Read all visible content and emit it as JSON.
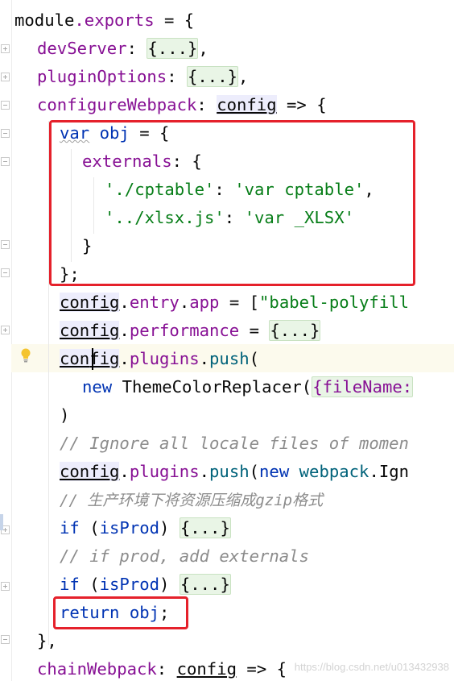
{
  "editor": {
    "lines": [
      {
        "id": "l1",
        "parts": {
          "a": "module",
          "b": ".exports",
          "c": " = {"
        }
      },
      {
        "id": "l2",
        "parts": {
          "a": "devServer",
          "b": ": ",
          "c": "{...}",
          "d": ","
        }
      },
      {
        "id": "l3",
        "parts": {
          "a": "pluginOptions",
          "b": ": ",
          "c": "{...}",
          "d": ","
        }
      },
      {
        "id": "l4",
        "parts": {
          "a": "configureWebpack",
          "b": ": ",
          "c": "config",
          "d": " => {"
        }
      },
      {
        "id": "l5",
        "parts": {
          "a": "var",
          "b": " ",
          "c": "obj",
          "d": " = {"
        }
      },
      {
        "id": "l6",
        "parts": {
          "a": "externals",
          "b": ": {"
        }
      },
      {
        "id": "l7",
        "parts": {
          "a": "'./cptable'",
          "b": ": ",
          "c": "'var cptable'",
          "d": ","
        }
      },
      {
        "id": "l8",
        "parts": {
          "a": "'../xlsx.js'",
          "b": ": ",
          "c": "'var _XLSX'"
        }
      },
      {
        "id": "l9",
        "parts": {
          "a": "}"
        }
      },
      {
        "id": "l10",
        "parts": {
          "a": "};"
        }
      },
      {
        "id": "l11",
        "parts": {
          "a": "config",
          "b": ".",
          "c": "entry",
          "d": ".",
          "e": "app",
          "f": " = [",
          "g": "\"babel-polyfill"
        }
      },
      {
        "id": "l12",
        "parts": {
          "a": "config",
          "b": ".",
          "c": "performance",
          "d": " = ",
          "e": "{...}"
        }
      },
      {
        "id": "l13",
        "parts": {
          "a": "con",
          "b": "fig",
          "c": ".",
          "d": "plugins",
          "e": ".",
          "f": "push",
          "g": "("
        }
      },
      {
        "id": "l14",
        "parts": {
          "a": "new",
          "b": " ThemeColorReplacer(",
          "c": "{fileName:"
        }
      },
      {
        "id": "l15",
        "parts": {
          "a": ")"
        }
      },
      {
        "id": "l16",
        "parts": {
          "a": "// Ignore all locale files of momen"
        }
      },
      {
        "id": "l17",
        "parts": {
          "a": "config",
          "b": ".",
          "c": "plugins",
          "d": ".",
          "e": "push",
          "f": "(",
          "g": "new",
          "h": " ",
          "i": "webpack",
          "j": ".Ign"
        }
      },
      {
        "id": "l18",
        "parts": {
          "a": "// 生产环境下将资源压缩成gzip格式"
        }
      },
      {
        "id": "l19",
        "parts": {
          "a": "if",
          "b": " (",
          "c": "isProd",
          "d": ") ",
          "e": "{...}"
        }
      },
      {
        "id": "l20",
        "parts": {
          "a": "// if prod, add externals"
        }
      },
      {
        "id": "l21",
        "parts": {
          "a": "if",
          "b": " (",
          "c": "isProd",
          "d": ") ",
          "e": "{...}"
        }
      },
      {
        "id": "l22",
        "parts": {
          "a": "return",
          "b": " ",
          "c": "obj",
          "d": ";"
        }
      },
      {
        "id": "l23",
        "parts": {
          "a": "},"
        }
      },
      {
        "id": "l24",
        "parts": {
          "a": "chainWebpack",
          "b": ": ",
          "c": "config",
          "d": " => {"
        }
      }
    ]
  },
  "watermark": "https://blog.csdn.net/u013432938",
  "colors": {
    "keyword": "#0033b3",
    "property": "#871094",
    "string": "#067d17",
    "comment": "#8c8c8c",
    "function": "#00627a",
    "highlight_box": "#e5212b"
  },
  "icons": {
    "intention": "lightbulb-icon",
    "fold_expand": "fold-plus-icon",
    "fold_collapse": "fold-minus-icon"
  }
}
